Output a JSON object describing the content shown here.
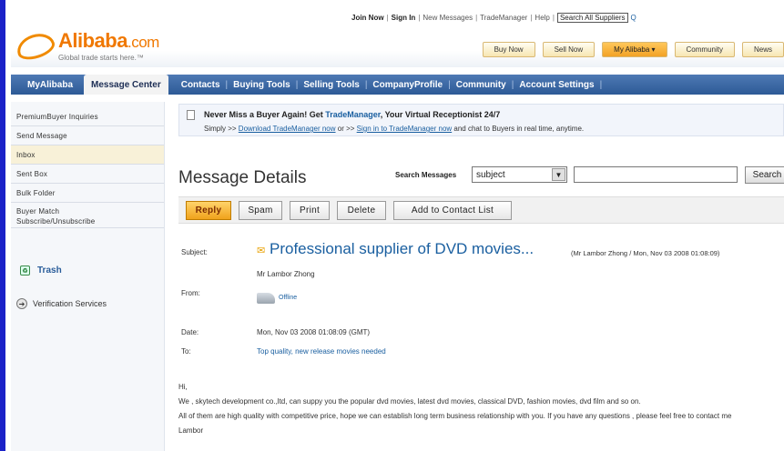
{
  "toplinks": {
    "join_now": "Join Now",
    "sign_in": "Sign In",
    "new_messages": "New Messages",
    "trademanager": "TradeManager",
    "help": "Help",
    "search_all_suppliers": "Search All Suppliers"
  },
  "logo": {
    "brand": "Alibaba",
    "suffix": ".com",
    "tagline": "Global trade starts here.™"
  },
  "header_buttons": [
    "Buy Now",
    "Sell Now",
    "My Alibaba ▾",
    "Community",
    "News"
  ],
  "nav": {
    "my_alibaba": "MyAlibaba",
    "message_center": "Message Center",
    "items": [
      "Contacts",
      "Buying Tools",
      "Selling Tools",
      "CompanyProfile",
      "Community",
      "Account Settings"
    ]
  },
  "sidebar": {
    "items": [
      "PremiumBuyer Inquiries",
      "Send Message",
      "Inbox",
      "Sent Box",
      "Bulk Folder"
    ],
    "buyer_match": "Buyer Match",
    "subscribe": "Subscribe/Unsubscribe",
    "trash": "Trash",
    "verification": "Verification Services"
  },
  "banner": {
    "headline_pre": "Never Miss a Buyer Again! Get ",
    "headline_link": "TradeManager",
    "headline_post": ", Your Virtual Receptionist 24/7",
    "line2_pre": "Simply >> ",
    "download_link": "Download TradeManager now",
    "line2_mid": " or >> ",
    "signin_link": "Sign in to TradeManager now",
    "line2_post": " and chat to Buyers in real time, anytime."
  },
  "page": {
    "title": "Message Details",
    "search_label": "Search Messages",
    "search_select": "subject",
    "search_button": "Search"
  },
  "toolbar": {
    "reply": "Reply",
    "spam": "Spam",
    "print": "Print",
    "delete": "Delete",
    "add_contact": "Add to Contact List"
  },
  "message": {
    "subject_label": "Subject:",
    "subject": "Professional supplier of DVD movies...",
    "subject_meta": "(Mr Lambor Zhong / Mon, Nov 03 2008 01:08:09)",
    "sender_name": "Mr Lambor Zhong",
    "from_label": "From:",
    "status": "Offline",
    "date_label": "Date:",
    "date": "Mon, Nov 03 2008 01:08:09 (GMT)",
    "to_label": "To:",
    "to": "Top quality, new release movies needed",
    "body": [
      "Hi,",
      "We , skytech development co.,ltd, can suppy you the popular dvd movies, latest dvd movies, classical DVD, fashion movies, dvd film and so on.",
      "All of them are high quality with competitive price, hope we can establish long term business relationship with you. If you have any questions , please feel free to contact me",
      "Lambor"
    ]
  }
}
